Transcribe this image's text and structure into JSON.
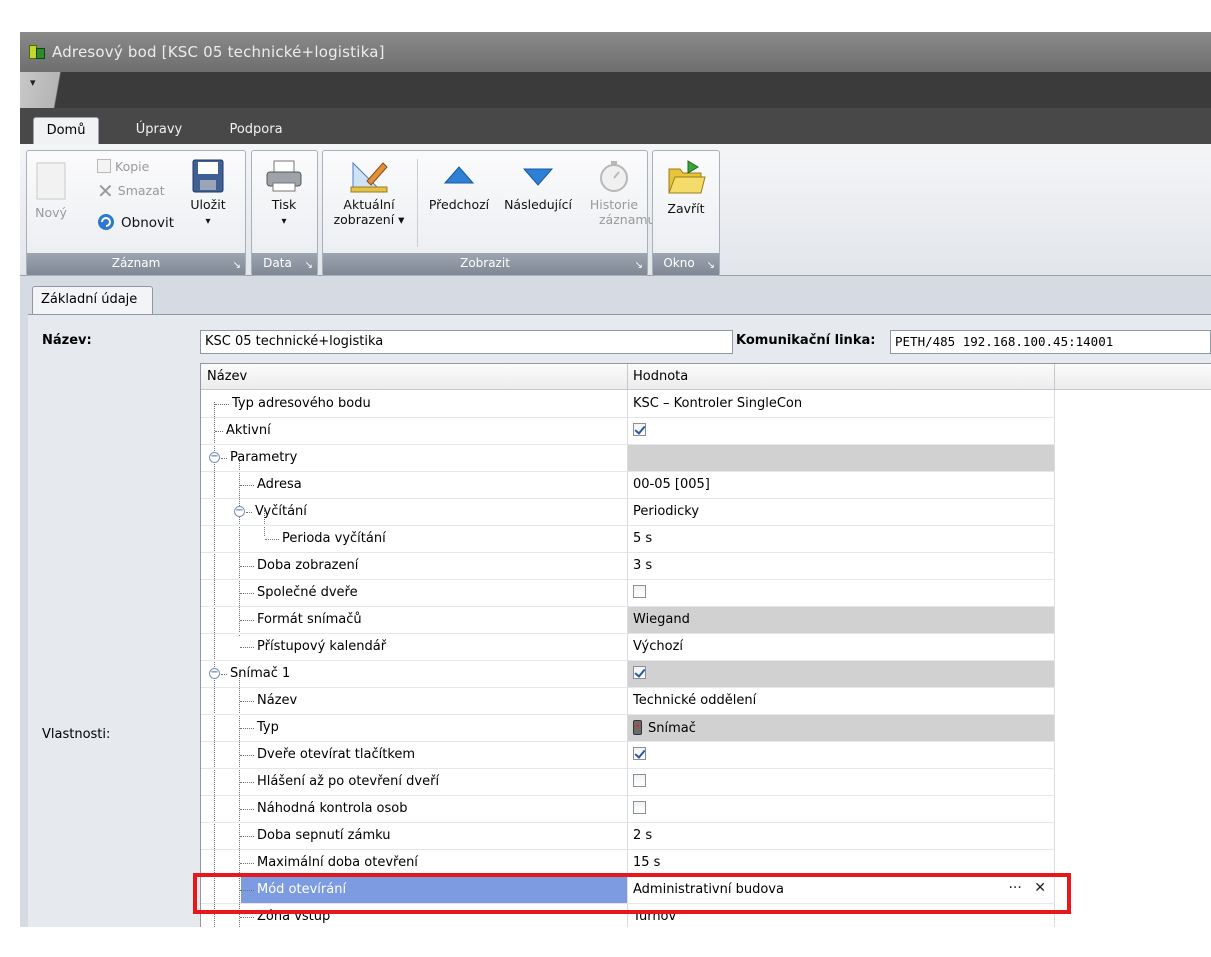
{
  "window": {
    "title": "Adresový bod [KSC 05 technické+logistika]"
  },
  "quick_access": {
    "glyph": "▾"
  },
  "tabs": [
    {
      "label": "Domů",
      "active": true
    },
    {
      "label": "Úpravy",
      "active": false
    },
    {
      "label": "Podpora",
      "active": false
    }
  ],
  "ribbon": {
    "groups": {
      "zaznam": "Záznam",
      "data": "Data",
      "zobrazit": "Zobrazit",
      "okno": "Okno"
    },
    "buttons": {
      "novy": "Nový",
      "kopie": "Kopie",
      "smazat": "Smazat",
      "obnovit": "Obnovit",
      "ulozit": "Uložit",
      "tisk": "Tisk",
      "aktualni_1": "Aktuální",
      "aktualni_2": "zobrazení ▾",
      "predchozi": "Předchozí",
      "nasledujici": "Následující",
      "historie_1": "Historie",
      "historie_2": "záznamu",
      "zavrit": "Zavřít"
    },
    "dropdown_arrow": "▾",
    "launcher": "↘"
  },
  "form": {
    "subtab": "Základní údaje",
    "nazev_label": "Název:",
    "nazev_value": "KSC 05 technické+logistika",
    "linka_label": "Komunikační linka:",
    "linka_value": "PETH/485 192.168.100.45:14001",
    "vlastnosti_label": "Vlastnosti:"
  },
  "grid": {
    "headers": {
      "name": "Název",
      "value": "Hodnota"
    },
    "rows": [
      {
        "name": "Typ adresového bodu",
        "value": "KSC – Kontroler SingleCon"
      },
      {
        "name": "Aktivní",
        "checked": true
      },
      {
        "name": "Parametry",
        "value": ""
      },
      {
        "name": "Adresa",
        "value": "00-05 [005]"
      },
      {
        "name": "Vyčítání",
        "value": "Periodicky"
      },
      {
        "name": "Perioda vyčítání",
        "value": "5 s"
      },
      {
        "name": "Doba zobrazení",
        "value": "3 s"
      },
      {
        "name": "Společné dveře",
        "checked": false
      },
      {
        "name": "Formát snímačů",
        "value": "Wiegand"
      },
      {
        "name": "Přístupový kalendář",
        "value": "Výchozí"
      },
      {
        "name": "Snímač 1",
        "checked": true
      },
      {
        "name": "Název",
        "value": "Technické oddělení"
      },
      {
        "name": "Typ",
        "value": "Snímač"
      },
      {
        "name": "Dveře otevírat tlačítkem",
        "checked": true
      },
      {
        "name": "Hlášení až po otevření dveří",
        "checked": false
      },
      {
        "name": "Náhodná kontrola osob",
        "checked": false
      },
      {
        "name": "Doba sepnutí zámku",
        "value": "2 s"
      },
      {
        "name": "Maximální doba otevření",
        "value": "15 s"
      },
      {
        "name": "Mód otevírání",
        "value": "Administrativní budova"
      },
      {
        "name": "Zóna vstup",
        "value": "Turnov"
      }
    ],
    "edit_buttons": {
      "more": "···",
      "clear": "✕"
    }
  },
  "colors": {
    "selection": "#7d9be0",
    "highlight_box": "#e8171c",
    "group_label": "#8a939f"
  }
}
